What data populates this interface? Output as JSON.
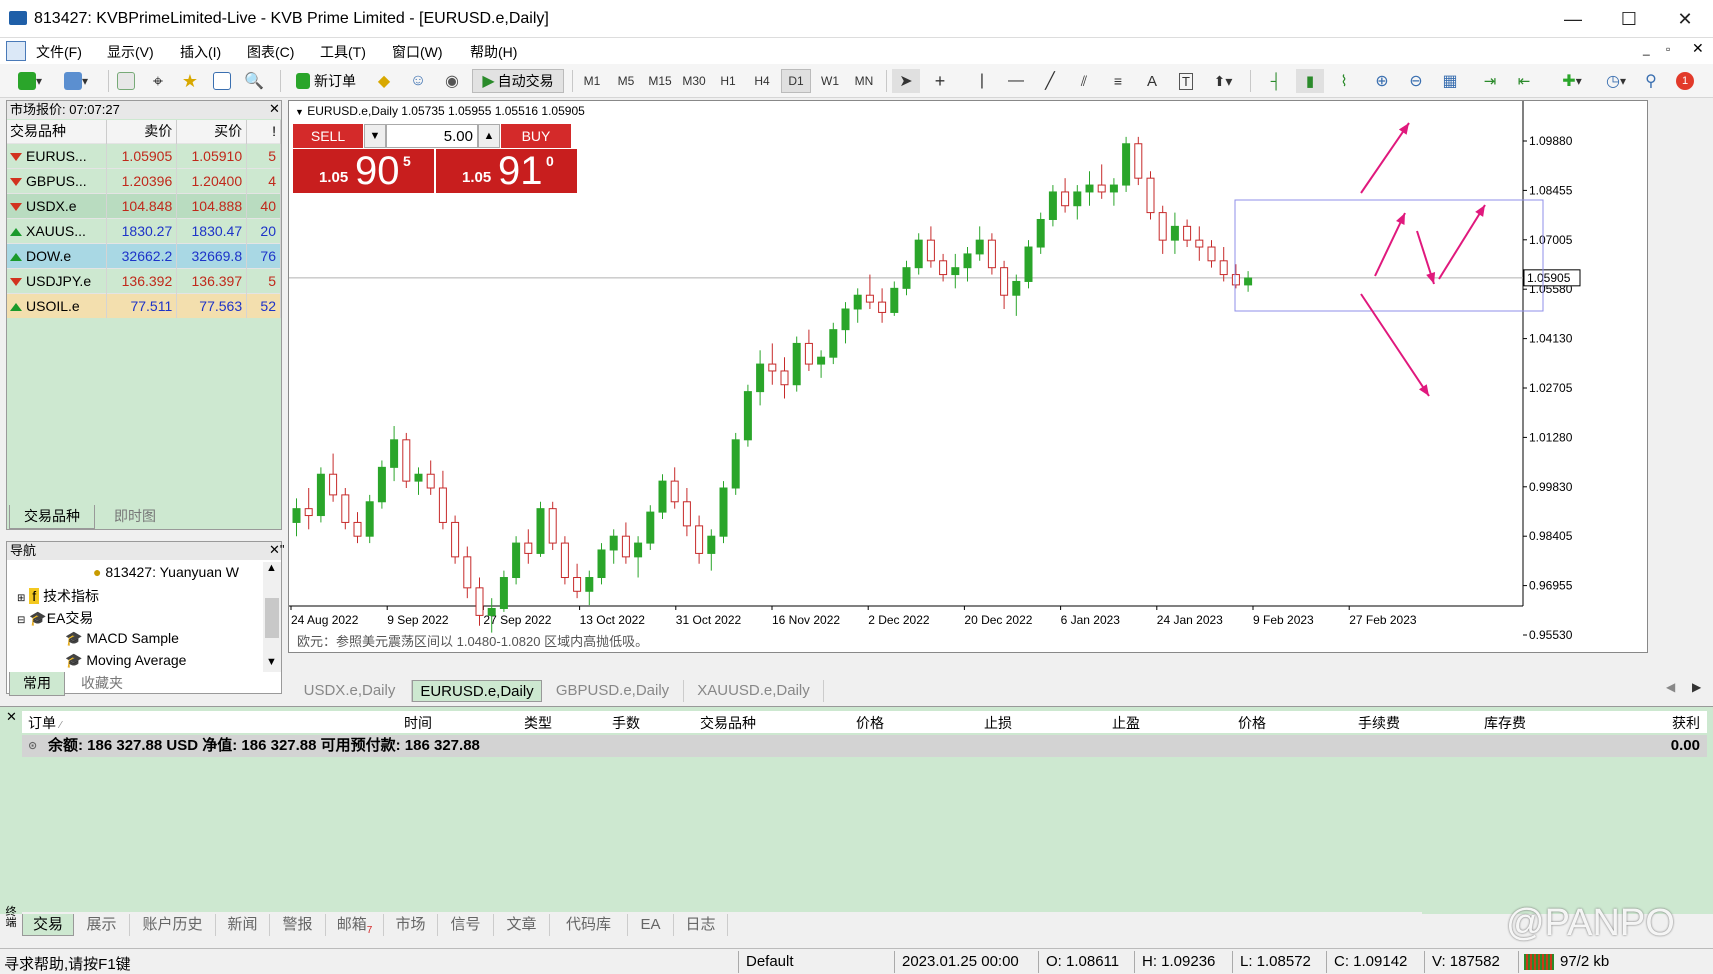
{
  "window": {
    "title": "813427: KVBPrimeLimited-Live - KVB Prime Limited - [EURUSD.e,Daily]"
  },
  "menu": [
    "文件(F)",
    "显示(V)",
    "插入(I)",
    "图表(C)",
    "工具(T)",
    "窗口(W)",
    "帮助(H)"
  ],
  "toolbar": {
    "new_order": "新订单",
    "auto_trade": "自动交易",
    "timeframes": [
      "M1",
      "M5",
      "M15",
      "M30",
      "H1",
      "H4",
      "D1",
      "W1",
      "MN"
    ],
    "active_timeframe": "D1",
    "notification_count": "1"
  },
  "market_watch": {
    "title": "市场报价: 07:07:27",
    "headers": {
      "symbol": "交易品种",
      "bid": "卖价",
      "ask": "买价",
      "spread": "!"
    },
    "rows": [
      {
        "symbol": "EURUS...",
        "bid": "1.05905",
        "ask": "1.05910",
        "spread": "5",
        "dir": "down",
        "bg": "#cde8d0",
        "color": "#c0281a"
      },
      {
        "symbol": "GBPUS...",
        "bid": "1.20396",
        "ask": "1.20400",
        "spread": "4",
        "dir": "down",
        "bg": "#cde8d0",
        "color": "#c0281a"
      },
      {
        "symbol": "USDX.e",
        "bid": "104.848",
        "ask": "104.888",
        "spread": "40",
        "dir": "down",
        "bg": "#b9dcc0",
        "color": "#c0281a"
      },
      {
        "symbol": "XAUUS...",
        "bid": "1830.27",
        "ask": "1830.47",
        "spread": "20",
        "dir": "up",
        "bg": "#cde8d0",
        "color": "#1d33c8"
      },
      {
        "symbol": "DOW.e",
        "bid": "32662.2",
        "ask": "32669.8",
        "spread": "76",
        "dir": "up",
        "bg": "#a9d8e4",
        "color": "#1d33c8"
      },
      {
        "symbol": "USDJPY.e",
        "bid": "136.392",
        "ask": "136.397",
        "spread": "5",
        "dir": "down",
        "bg": "#cde8d0",
        "color": "#c0281a"
      },
      {
        "symbol": "USOIL.e",
        "bid": "77.511",
        "ask": "77.563",
        "spread": "52",
        "dir": "up",
        "bg": "#f3dfae",
        "color": "#1d33c8"
      }
    ],
    "tabs": [
      "交易品种",
      "即时图"
    ]
  },
  "navigator": {
    "title": "导航",
    "items": [
      "813427: Yuanyuan W",
      "技术指标",
      "EA交易",
      "MACD Sample",
      "Moving Average"
    ],
    "tabs": [
      "常用",
      "收藏夹"
    ]
  },
  "chart": {
    "symbol_info": "EURUSD.e,Daily  1.05735 1.05955 1.05516 1.05905",
    "sell_label": "SELL",
    "buy_label": "BUY",
    "lot": "5.00",
    "sell_price": {
      "prefix": "1.05",
      "big": "90",
      "sup": "5"
    },
    "buy_price": {
      "prefix": "1.05",
      "big": "91",
      "sup": "0"
    },
    "annotation": "欧元：参照美元震荡区间以 1.0480-1.0820 区域内高抛低吸。",
    "price_ticks": [
      "1.09880",
      "1.08455",
      "1.07005",
      "1.05580",
      "1.04130",
      "1.02705",
      "1.01280",
      "0.99830",
      "0.98405",
      "0.96955",
      "0.95530"
    ],
    "current_price": "1.05905",
    "date_ticks": [
      "24 Aug 2022",
      "9 Sep 2022",
      "27 Sep 2022",
      "13 Oct 2022",
      "31 Oct 2022",
      "16 Nov 2022",
      "2 Dec 2022",
      "20 Dec 2022",
      "6 Jan 2023",
      "24 Jan 2023",
      "9 Feb 2023",
      "27 Feb 2023"
    ],
    "bull_color": "#2aa52a",
    "bear_color": "#c62a2a",
    "arrow_color": "#e0197d",
    "box_color": "#8f8fe8"
  },
  "chart_data": {
    "type": "candlestick",
    "ylim": [
      0.95,
      1.105
    ],
    "series": [
      {
        "ohlc": [
          [
            0.988,
            0.995,
            0.984,
            0.992
          ],
          [
            0.992,
            0.998,
            0.986,
            0.99
          ],
          [
            0.99,
            1.004,
            0.988,
            1.002
          ],
          [
            1.002,
            1.008,
            0.994,
            0.996
          ],
          [
            0.996,
            0.998,
            0.986,
            0.988
          ],
          [
            0.988,
            0.991,
            0.982,
            0.984
          ],
          [
            0.984,
            0.996,
            0.982,
            0.994
          ],
          [
            0.994,
            1.006,
            0.992,
            1.004
          ],
          [
            1.004,
            1.016,
            1.0,
            1.012
          ],
          [
            1.012,
            1.014,
            0.998,
            1.0
          ],
          [
            1.0,
            1.004,
            0.996,
            1.002
          ],
          [
            1.002,
            1.006,
            0.996,
            0.998
          ],
          [
            0.998,
            1.003,
            0.986,
            0.988
          ],
          [
            0.988,
            0.99,
            0.976,
            0.978
          ],
          [
            0.978,
            0.981,
            0.966,
            0.969
          ],
          [
            0.969,
            0.972,
            0.958,
            0.961
          ],
          [
            0.961,
            0.966,
            0.956,
            0.963
          ],
          [
            0.963,
            0.974,
            0.962,
            0.972
          ],
          [
            0.972,
            0.984,
            0.97,
            0.982
          ],
          [
            0.982,
            0.986,
            0.976,
            0.979
          ],
          [
            0.979,
            0.994,
            0.978,
            0.992
          ],
          [
            0.992,
            0.994,
            0.98,
            0.982
          ],
          [
            0.982,
            0.984,
            0.97,
            0.972
          ],
          [
            0.972,
            0.976,
            0.966,
            0.968
          ],
          [
            0.968,
            0.974,
            0.964,
            0.972
          ],
          [
            0.972,
            0.982,
            0.97,
            0.98
          ],
          [
            0.98,
            0.986,
            0.976,
            0.984
          ],
          [
            0.984,
            0.988,
            0.976,
            0.978
          ],
          [
            0.978,
            0.984,
            0.972,
            0.982
          ],
          [
            0.982,
            0.993,
            0.98,
            0.991
          ],
          [
            0.991,
            1.002,
            0.989,
            1.0
          ],
          [
            1.0,
            1.004,
            0.992,
            0.994
          ],
          [
            0.994,
            0.998,
            0.984,
            0.987
          ],
          [
            0.987,
            0.99,
            0.976,
            0.979
          ],
          [
            0.979,
            0.986,
            0.974,
            0.984
          ],
          [
            0.984,
            1.0,
            0.982,
            0.998
          ],
          [
            0.998,
            1.014,
            0.996,
            1.012
          ],
          [
            1.012,
            1.028,
            1.01,
            1.026
          ],
          [
            1.026,
            1.038,
            1.022,
            1.034
          ],
          [
            1.034,
            1.04,
            1.028,
            1.032
          ],
          [
            1.032,
            1.036,
            1.024,
            1.028
          ],
          [
            1.028,
            1.042,
            1.026,
            1.04
          ],
          [
            1.04,
            1.044,
            1.032,
            1.034
          ],
          [
            1.034,
            1.038,
            1.03,
            1.036
          ],
          [
            1.036,
            1.046,
            1.034,
            1.044
          ],
          [
            1.044,
            1.052,
            1.04,
            1.05
          ],
          [
            1.05,
            1.056,
            1.046,
            1.054
          ],
          [
            1.054,
            1.06,
            1.05,
            1.052
          ],
          [
            1.052,
            1.056,
            1.046,
            1.049
          ],
          [
            1.049,
            1.058,
            1.048,
            1.056
          ],
          [
            1.056,
            1.064,
            1.054,
            1.062
          ],
          [
            1.062,
            1.072,
            1.06,
            1.07
          ],
          [
            1.07,
            1.074,
            1.062,
            1.064
          ],
          [
            1.064,
            1.066,
            1.058,
            1.06
          ],
          [
            1.06,
            1.066,
            1.056,
            1.062
          ],
          [
            1.062,
            1.068,
            1.058,
            1.066
          ],
          [
            1.066,
            1.074,
            1.064,
            1.07
          ],
          [
            1.07,
            1.072,
            1.06,
            1.062
          ],
          [
            1.062,
            1.064,
            1.05,
            1.054
          ],
          [
            1.054,
            1.06,
            1.048,
            1.058
          ],
          [
            1.058,
            1.07,
            1.056,
            1.068
          ],
          [
            1.068,
            1.078,
            1.066,
            1.076
          ],
          [
            1.076,
            1.086,
            1.074,
            1.084
          ],
          [
            1.084,
            1.088,
            1.078,
            1.08
          ],
          [
            1.08,
            1.086,
            1.076,
            1.084
          ],
          [
            1.084,
            1.09,
            1.08,
            1.086
          ],
          [
            1.086,
            1.092,
            1.082,
            1.084
          ],
          [
            1.084,
            1.088,
            1.08,
            1.086
          ],
          [
            1.086,
            1.1,
            1.084,
            1.098
          ],
          [
            1.098,
            1.1,
            1.086,
            1.088
          ],
          [
            1.088,
            1.09,
            1.076,
            1.078
          ],
          [
            1.078,
            1.08,
            1.066,
            1.07
          ],
          [
            1.07,
            1.078,
            1.066,
            1.074
          ],
          [
            1.074,
            1.076,
            1.068,
            1.07
          ],
          [
            1.07,
            1.074,
            1.064,
            1.068
          ],
          [
            1.068,
            1.07,
            1.062,
            1.064
          ],
          [
            1.064,
            1.068,
            1.058,
            1.06
          ],
          [
            1.06,
            1.063,
            1.056,
            1.057
          ],
          [
            1.057,
            1.061,
            1.055,
            1.059
          ]
        ]
      }
    ]
  },
  "chart_tabs": [
    "USDX.e,Daily",
    "EURUSD.e,Daily",
    "GBPUSD.e,Daily",
    "XAUUSD.e,Daily"
  ],
  "active_chart_tab": 1,
  "terminal": {
    "headers": [
      "订单",
      "时间",
      "类型",
      "手数",
      "交易品种",
      "价格",
      "止损",
      "止盈",
      "价格",
      "手续费",
      "库存费",
      "获利"
    ],
    "balance_line": "余额: 186 327.88 USD  净值: 186 327.88  可用预付款: 186 327.88",
    "profit": "0.00",
    "tabs": [
      "交易",
      "展示",
      "账户历史",
      "新闻",
      "警报",
      "邮箱",
      "市场",
      "信号",
      "文章",
      "代码库",
      "EA",
      "日志"
    ],
    "mail_count": "7",
    "side_label": "终端"
  },
  "status": {
    "help": "寻求帮助,请按F1键",
    "profile": "Default",
    "datetime": "2023.01.25 00:00",
    "open": "O: 1.08611",
    "high": "H: 1.09236",
    "low": "L: 1.08572",
    "close": "C: 1.09142",
    "volume": "V: 187582",
    "traffic": "97/2 kb"
  },
  "watermark": "@PANPO"
}
